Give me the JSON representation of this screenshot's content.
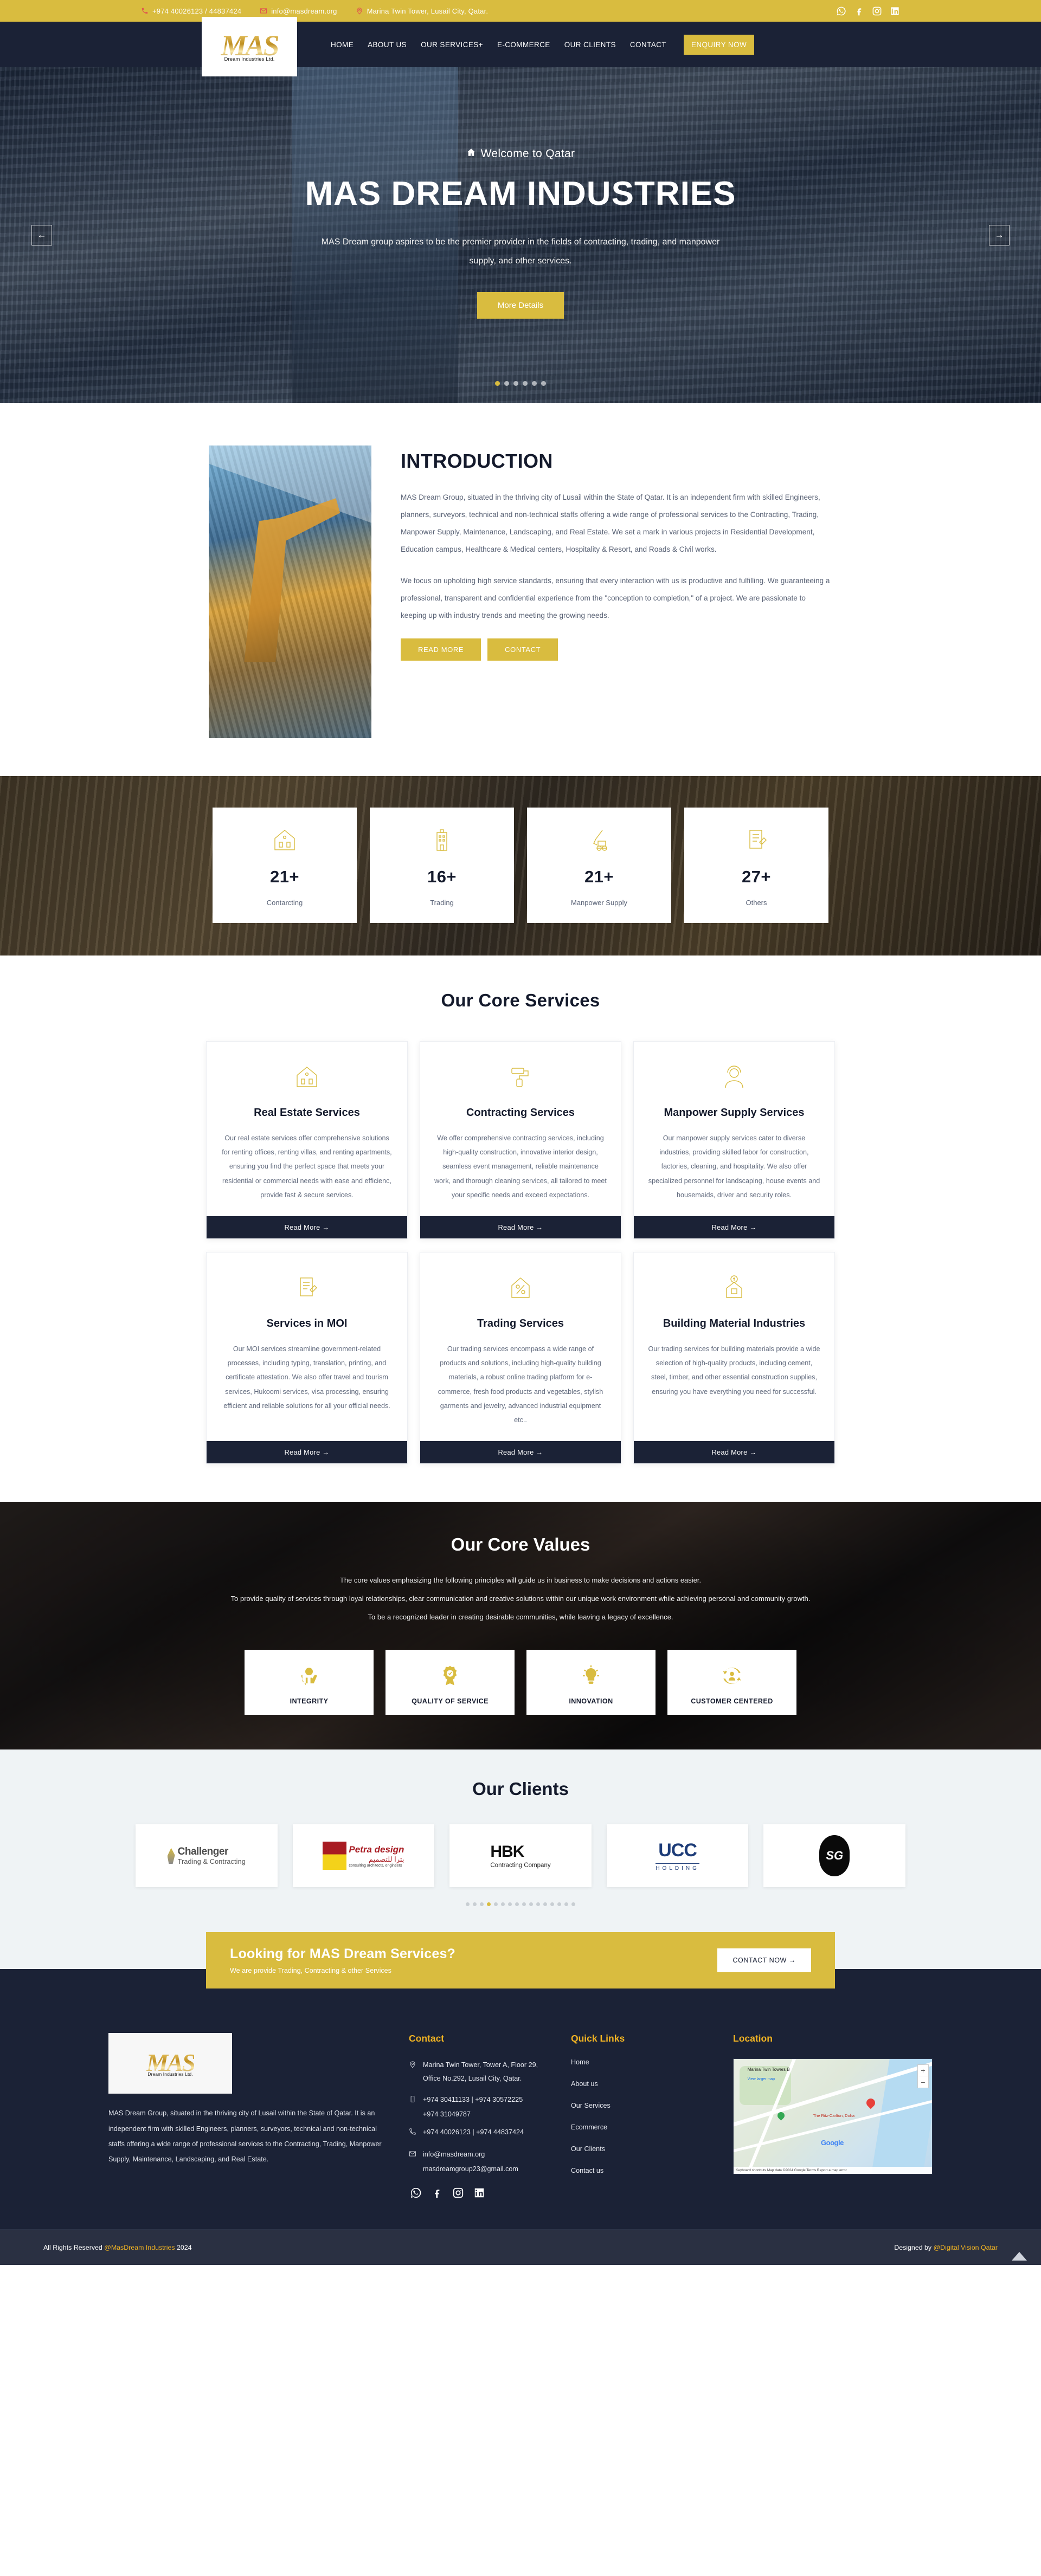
{
  "topbar": {
    "phone": "+974 40026123 / 44837424",
    "email": "info@masdream.org",
    "address": "Marina Twin Tower, Lusail City, Qatar.",
    "socials": [
      "whatsapp-icon",
      "facebook-icon",
      "instagram-icon",
      "linkedin-icon"
    ]
  },
  "brand": {
    "mark": "MAS",
    "tagline": "Dream Industries Ltd."
  },
  "nav": {
    "items": [
      {
        "label": "HOME"
      },
      {
        "label": "ABOUT US"
      },
      {
        "label": "OUR SERVICES+"
      },
      {
        "label": "E-COMMERCE"
      },
      {
        "label": "OUR CLIENTS"
      },
      {
        "label": "CONTACT"
      }
    ],
    "cta": "ENQUIRY NOW"
  },
  "hero": {
    "eyebrow": "Welcome to Qatar",
    "title": "MAS DREAM INDUSTRIES",
    "subtitle": "MAS Dream group aspires to be the premier provider in the fields of contracting, trading, and manpower supply, and other services.",
    "button": "More Details",
    "prev": "←",
    "next": "→",
    "dots_total": 6,
    "dot_active": 1
  },
  "intro": {
    "title": "INTRODUCTION",
    "paragraph1": "MAS Dream Group, situated in the thriving city of Lusail within the State of Qatar. It is an independent firm with skilled Engineers, planners, surveyors, technical and non-technical staffs offering a wide range of professional services to the Contracting, Trading, Manpower Supply, Maintenance, Landscaping, and Real Estate. We set a mark in various projects in Residential Development, Education campus, Healthcare & Medical centers, Hospitality & Resort, and Roads & Civil works.",
    "paragraph2": "We focus on upholding high service standards, ensuring that every interaction with us is productive and fulfilling. We guaranteeing a professional, transparent and confidential experience from the \"conception to completion,\" of a project. We are passionate to keeping up with industry trends and meeting the growing needs.",
    "btn_read_more": "READ MORE",
    "btn_contact": "CONTACT"
  },
  "stats": [
    {
      "icon": "house-icon",
      "value": "21+",
      "label": "Contarcting"
    },
    {
      "icon": "building-icon",
      "value": "16+",
      "label": "Trading"
    },
    {
      "icon": "excavator-icon",
      "value": "21+",
      "label": "Manpower Supply"
    },
    {
      "icon": "contract-icon",
      "value": "27+",
      "label": "Others"
    }
  ],
  "services": {
    "title": "Our Core Services",
    "read_more": "Read More →",
    "cards": [
      {
        "icon": "house-icon",
        "name": "Real Estate Services",
        "desc": "Our real estate services offer comprehensive solutions for renting offices, renting villas, and renting apartments, ensuring you find the perfect space that meets your residential or commercial needs with ease and efficienc, provide fast & secure services."
      },
      {
        "icon": "paint-roller-icon",
        "name": "Contracting Services",
        "desc": "We offer comprehensive contracting services, including high-quality construction, innovative interior design, seamless event management, reliable maintenance work, and thorough cleaning services, all tailored to meet your specific needs and exceed expectations."
      },
      {
        "icon": "worker-icon",
        "name": "Manpower Supply Services",
        "desc": "Our manpower supply services cater to diverse industries, providing skilled labor for construction, factories, cleaning, and hospitality. We also offer specialized personnel for landscaping, house events and housemaids, driver and security roles."
      },
      {
        "icon": "contract-icon",
        "name": "Services in MOI",
        "desc": "Our MOI services streamline government-related processes, including typing, translation, printing, and certificate attestation. We also offer travel and tourism services, Hukoomi services, visa processing, ensuring efficient and reliable solutions for all your official needs."
      },
      {
        "icon": "house-percent-icon",
        "name": "Trading Services",
        "desc": "Our trading services encompass a wide range of products and solutions, including high-quality building materials, a robust online trading platform for e-commerce, fresh food products and vegetables, stylish garments and jewelry, advanced industrial equipment etc.."
      },
      {
        "icon": "house-dollar-icon",
        "name": "Building Material Industries",
        "desc": "Our trading services for building materials provide a wide selection of high-quality products, including cement, steel, timber, and other essential construction supplies, ensuring you have everything you need for successful."
      }
    ]
  },
  "values": {
    "title": "Our Core Values",
    "lines": [
      "The core values emphasizing the following principles will guide us in business to make decisions and actions easier.",
      "To provide quality of services through loyal relationships, clear communication and creative solutions within our unique work environment while achieving personal and community growth.",
      "To be a recognized leader in creating desirable communities, while leaving a legacy of excellence."
    ],
    "items": [
      {
        "icon": "hands-globe-icon",
        "label": "INTEGRITY"
      },
      {
        "icon": "award-ribbon-icon",
        "label": "QUALITY OF SERVICE"
      },
      {
        "icon": "lightbulb-icon",
        "label": "INNOVATION"
      },
      {
        "icon": "customer-cycle-icon",
        "label": "CUSTOMER CENTERED"
      }
    ]
  },
  "clients": {
    "title": "Our Clients",
    "logos": [
      {
        "name": "Challenger",
        "sub": "Trading & Contracting"
      },
      {
        "name": "Petra design",
        "sub": "consulting architects, engineers"
      },
      {
        "name": "HBK",
        "sub": "Contracting Company"
      },
      {
        "name": "UCC",
        "sub": "HOLDING"
      },
      {
        "name": "SG",
        "sub": ""
      }
    ],
    "dots_total": 16,
    "dot_active": 4
  },
  "cta": {
    "heading": "Looking for MAS Dream Services?",
    "sub": "We are provide Trading, Contracting & other Services",
    "button": "CONTACT NOW  →"
  },
  "footer": {
    "about": "MAS Dream Group, situated in the thriving city of Lusail within the State of Qatar. It is an independent firm with skilled Engineers, planners, surveyors, technical and non-technical staffs offering a wide range of professional services to the Contracting, Trading, Manpower Supply, Maintenance, Landscaping, and Real Estate.",
    "contact": {
      "heading": "Contact",
      "address": "Marina Twin Tower, Tower A, Floor 29, Office No.292, Lusail City, Qatar.",
      "mobile": "+974 30411133 | +974 30572225",
      "mobile2": "+974 31049787",
      "phone": "+974 40026123 | +974 44837424",
      "email": "info@masdream.org",
      "email2": "masdreamgroup23@gmail.com"
    },
    "quick_links": {
      "heading": "Quick Links",
      "items": [
        "Home",
        "About us",
        "Our Services",
        "Ecommerce",
        "Our Clients",
        "Contact us"
      ]
    },
    "location": {
      "heading": "Location",
      "map_title": "Marina Twin Towers B",
      "view_larger": "View larger map",
      "place_label": "The Ritz-Carlton, Doha",
      "google_label": "Google",
      "attrib": "Keyboard shortcuts   Map data ©2024 Google   Terms   Report a map error",
      "zoom_in": "+",
      "zoom_out": "−"
    },
    "socials": [
      "whatsapp-icon",
      "facebook-icon",
      "instagram-icon",
      "linkedin-icon"
    ],
    "bottom_left_a": "All Rights Reserved ",
    "bottom_left_b": "@MasDream Industries",
    "bottom_left_c": " 2024",
    "bottom_right_a": "Designed by ",
    "bottom_right_b": "@Digital Vision Qatar"
  },
  "colors": {
    "gold": "#d9bc3f",
    "navy": "#1b2236",
    "footer_gold": "#f0b323"
  }
}
